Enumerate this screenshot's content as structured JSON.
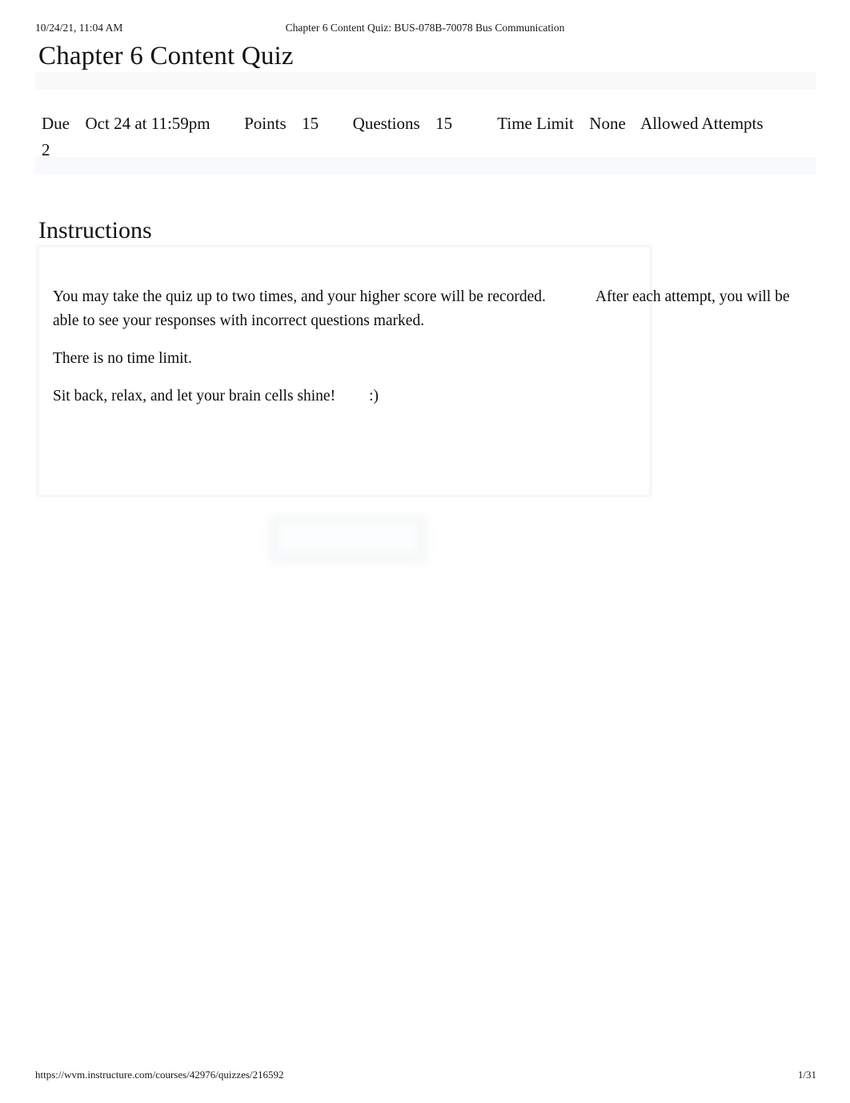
{
  "print_header": {
    "date": "10/24/21, 11:04 AM",
    "document_title": "Chapter 6 Content Quiz: BUS-078B-70078 Bus Communication"
  },
  "page": {
    "title": "Chapter 6 Content Quiz"
  },
  "quiz_meta": {
    "due_label": "Due",
    "due_value": "Oct 24 at 11:59pm",
    "points_label": "Points",
    "points_value": "15",
    "questions_label": "Questions",
    "questions_value": "15",
    "time_limit_label": "Time Limit",
    "time_limit_value": "None",
    "allowed_attempts_label": "Allowed Attempts",
    "allowed_attempts_value": "2"
  },
  "instructions": {
    "heading": "Instructions",
    "paragraph_1_part_1": "You may take the quiz up to two times, and your higher score will be recorded.",
    "paragraph_1_part_2": "After each attempt, you will be able to see your responses with incorrect questions marked.",
    "paragraph_2": "There is no time limit.",
    "paragraph_3_part_1": "Sit back, relax, and let your brain cells shine!",
    "paragraph_3_part_2": ":)"
  },
  "take_quiz_button": {
    "label": ""
  },
  "print_footer": {
    "url": "https://wvm.instructure.com/courses/42976/quizzes/216592",
    "page_number": "1/31"
  },
  "colors": {
    "text": "#0a0a0a",
    "band": "#f8f9fa",
    "box_border": "#eceef0"
  }
}
